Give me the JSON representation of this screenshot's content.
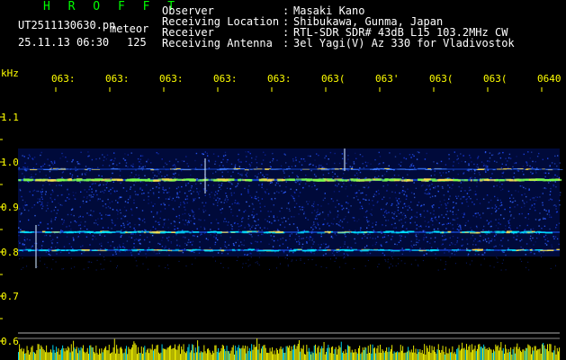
{
  "brand": "H R O F F T",
  "file": {
    "name": "UT2511130630.pn",
    "tag": "meteor",
    "datetime": "25.11.13 06:30",
    "count": "125"
  },
  "info": [
    {
      "label": "Observer",
      "value": "Masaki Kano"
    },
    {
      "label": "Receiving Location",
      "value": "Shibukawa, Gunma, Japan"
    },
    {
      "label": "Receiver",
      "value": "RTL-SDR SDR# 43dB L15 103.2MHz CW"
    },
    {
      "label": "Receiving Antenna",
      "value": "3el Yagi(V) Az 330 for Vladivostok"
    }
  ],
  "separator": ":",
  "axes": {
    "y_unit": "kHz",
    "y_ticks": [
      "1.1",
      "1.0",
      "0.9",
      "0.8",
      "0.7",
      "0.6"
    ],
    "x_ticks": [
      "063:",
      "063:",
      "063:",
      "063:",
      "063:",
      "063(",
      "063'",
      "063(",
      "063(",
      "0640"
    ]
  },
  "colors": {
    "background": "#000000",
    "label_yellow": "#ffff00",
    "brand_green": "#00ff00",
    "text_white": "#ffffff",
    "echo_blue": "#1a3cff",
    "trace_cyan": "#00e5ff"
  }
}
